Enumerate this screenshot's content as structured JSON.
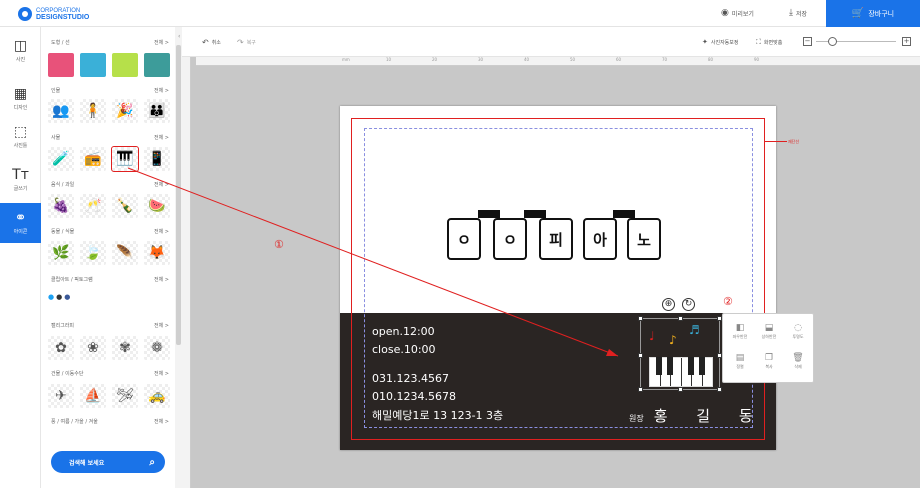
{
  "brand": {
    "line1": "CORPORATION",
    "line2": "DESIGNSTUDIO"
  },
  "topbar": {
    "preview": "미리보기",
    "save": "저장",
    "cart": "장바구니"
  },
  "rail": [
    {
      "label": "사진",
      "icon": "camera-icon"
    },
    {
      "label": "디자인",
      "icon": "layout-icon"
    },
    {
      "label": "사진틀",
      "icon": "frame-icon"
    },
    {
      "label": "글쓰기",
      "icon": "text-icon"
    },
    {
      "label": "아이콘",
      "icon": "shapes-icon"
    }
  ],
  "panel": {
    "more": "전체 >",
    "categories": [
      "도형 / 선",
      "인물",
      "사물",
      "음식 / 과일",
      "동물 / 식물",
      "클립아트 / 픽토그램",
      "캘리그라피",
      "건물 / 이동수단",
      "풍 / 여름 / 가을 / 겨울"
    ],
    "search_label": "검색해 보세요"
  },
  "toolbar": {
    "undo": "취소",
    "redo": "복구",
    "auto_fix": "사진자동보정",
    "fit": "화면맞춤"
  },
  "ruler": {
    "unit": "mm",
    "ticks": [
      "10",
      "20",
      "30",
      "40",
      "50",
      "60",
      "70",
      "80",
      "90"
    ]
  },
  "canvas": {
    "cut_label": "재단선",
    "keys": [
      "ㅇ",
      "ㅇ",
      "피",
      "아",
      "노"
    ],
    "info": [
      "open.12:00",
      "close.10:00",
      "031.123.4567",
      "010.1234.5678",
      "해밀예당1로 13 123-1 3층"
    ],
    "director_label": "원장",
    "director_name": "홍 길 동"
  },
  "context_menu": [
    {
      "label": "좌우반전",
      "icon": "flip-horizontal-icon"
    },
    {
      "label": "상하반전",
      "icon": "flip-vertical-icon"
    },
    {
      "label": "투명도",
      "icon": "opacity-icon"
    },
    {
      "label": "정렬",
      "icon": "align-icon"
    },
    {
      "label": "복사",
      "icon": "copy-icon"
    },
    {
      "label": "삭제",
      "icon": "trash-icon"
    }
  ],
  "annotations": {
    "one": "①",
    "two": "②"
  },
  "colors": {
    "accent": "#1a73e8",
    "annotation": "#e02020",
    "card_dark": "#2a2523"
  }
}
